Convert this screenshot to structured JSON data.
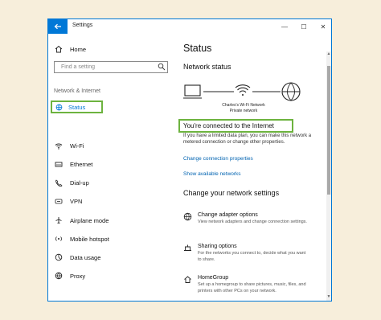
{
  "window": {
    "title": "Settings",
    "minimize": "—",
    "maximize": "☐",
    "close": "✕"
  },
  "sidebar": {
    "home_label": "Home",
    "search_placeholder": "Find a setting",
    "section_label": "Network & Internet",
    "items": [
      {
        "label": "Status",
        "icon": "globe-icon"
      },
      {
        "label": "Wi-Fi",
        "icon": "wifi-icon"
      },
      {
        "label": "Ethernet",
        "icon": "ethernet-icon"
      },
      {
        "label": "Dial-up",
        "icon": "phone-icon"
      },
      {
        "label": "VPN",
        "icon": "vpn-icon"
      },
      {
        "label": "Airplane mode",
        "icon": "airplane-icon"
      },
      {
        "label": "Mobile hotspot",
        "icon": "hotspot-icon"
      },
      {
        "label": "Data usage",
        "icon": "data-usage-icon"
      },
      {
        "label": "Proxy",
        "icon": "globe-icon"
      }
    ]
  },
  "main": {
    "title": "Status",
    "network_status_heading": "Network status",
    "network_name": "Charles's Wi-Fi Network",
    "network_type": "Private network",
    "connected_text": "You're connected to the Internet",
    "partial_text": "If you have a limited data plan, you can make this network a metered connection or change other properties.",
    "change_connection_link": "Change connection properties",
    "show_networks_link": "Show available networks",
    "change_settings_heading": "Change your network settings",
    "options": [
      {
        "title": "Change adapter options",
        "desc": "View network adapters and change connection settings.",
        "icon": "adapter-icon"
      },
      {
        "title": "Sharing options",
        "desc": "For the networks you connect to, decide what you want to share.",
        "icon": "sharing-icon"
      },
      {
        "title": "HomeGroup",
        "desc": "Set up a homegroup to share pictures, music, files, and printers with other PCs on your network.",
        "icon": "homegroup-icon"
      }
    ]
  },
  "colors": {
    "accent": "#0078d7",
    "highlight": "#6db33f",
    "link": "#0063b1",
    "background": "#f7eedb"
  }
}
